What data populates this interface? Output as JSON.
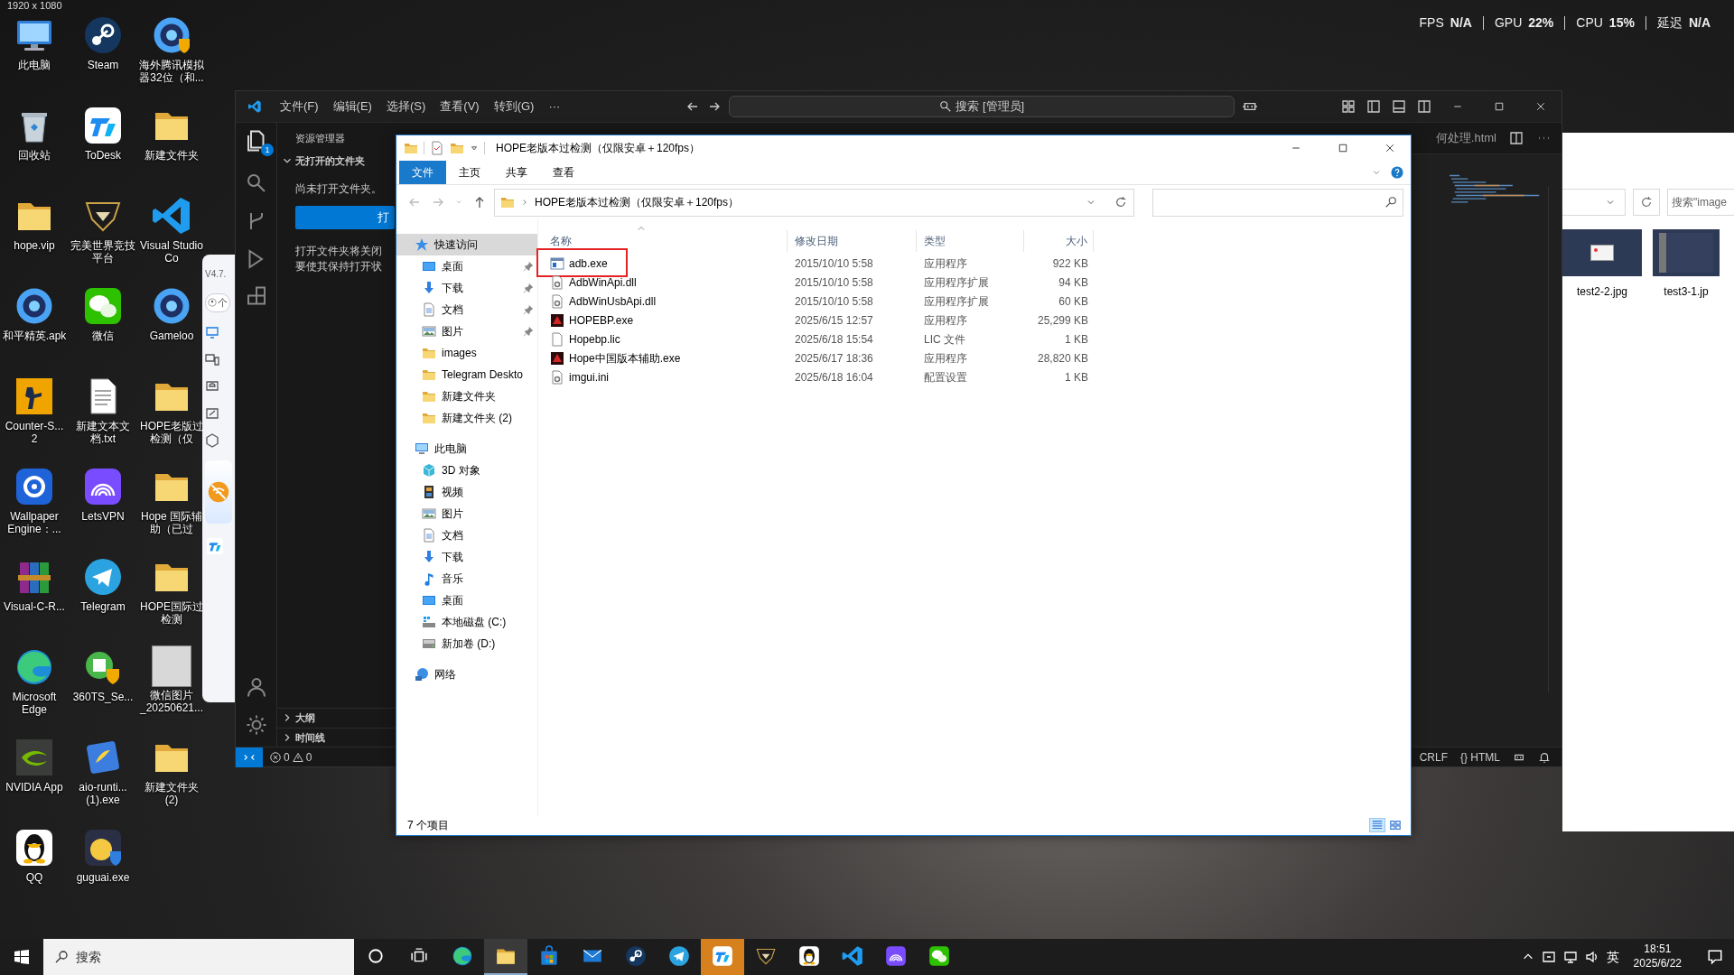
{
  "screenshot_size": "1920 x 1080",
  "perf_overlay": [
    {
      "label": "FPS",
      "value": "N/A"
    },
    {
      "label": "GPU",
      "value": "22%"
    },
    {
      "label": "CPU",
      "value": "15%"
    },
    {
      "label": "延迟",
      "value": "N/A"
    }
  ],
  "desktop_icons": [
    {
      "label": "此电脑",
      "kind": "pc"
    },
    {
      "label": "回收站",
      "kind": "bin"
    },
    {
      "label": "hope.vip",
      "kind": "folder"
    },
    {
      "label": "和平精英.apk",
      "kind": "ring"
    },
    {
      "label": "Counter-S... 2",
      "kind": "cs"
    },
    {
      "label": "Wallpaper Engine：...",
      "kind": "wallpaper"
    },
    {
      "label": "Visual-C-R...",
      "kind": "winrar"
    },
    {
      "label": "Microsoft Edge",
      "kind": "edge"
    },
    {
      "label": "NVIDIA App",
      "kind": "nvidia"
    },
    {
      "label": "QQ",
      "kind": "qq"
    },
    {
      "label": "Steam",
      "kind": "steam"
    },
    {
      "label": "ToDesk",
      "kind": "todesk"
    },
    {
      "label": "完美世界竞技平台",
      "kind": "perfect"
    },
    {
      "label": "微信",
      "kind": "wechat"
    },
    {
      "label": "新建文本文档.txt",
      "kind": "file"
    },
    {
      "label": "LetsVPN",
      "kind": "letsvpn"
    },
    {
      "label": "Telegram",
      "kind": "telegram"
    },
    {
      "label": "360TS_Se...",
      "kind": "shield360"
    },
    {
      "label": "aio-runti... (1).exe",
      "kind": "aio"
    },
    {
      "label": "guguai.exe",
      "kind": "guguai"
    },
    {
      "label": "海外腾讯模拟器32位（和...",
      "kind": "emulator"
    },
    {
      "label": "新建文件夹",
      "kind": "folder"
    },
    {
      "label": "Visual Studio Co",
      "kind": "vscode"
    },
    {
      "label": "Gameloo",
      "kind": "ring"
    },
    {
      "label": "HOPE老版过检测（仅",
      "kind": "folder"
    },
    {
      "label": "Hope 国际辅助（已过",
      "kind": "folder"
    },
    {
      "label": "HOPE国际过检测",
      "kind": "folder"
    },
    {
      "label": "微信图片\n_20250621...",
      "kind": "photo"
    },
    {
      "label": "新建文件夹\n(2)",
      "kind": "folder"
    }
  ],
  "side_panel": {
    "version": "V4.7.",
    "account": "个"
  },
  "vscode": {
    "menu": [
      "文件(F)",
      "编辑(E)",
      "选择(S)",
      "查看(V)",
      "转到(G)",
      "···"
    ],
    "search": "搜索 [管理员]",
    "explorer_badge": "1",
    "sidebar_title": "资源管理器",
    "section": {
      "label": "无打开的文件夹",
      "expanded": true
    },
    "no_folder_text": "尚未打开文件夹。",
    "open_button": "打",
    "hint_lines": [
      "打开文件夹将关闭",
      "要使其保持打开状"
    ],
    "bottom_sections": [
      {
        "label": "大纲",
        "expanded": false
      },
      {
        "label": "时间线",
        "expanded": false
      }
    ],
    "tab": "何处理.html",
    "errors": "0",
    "warnings": "0",
    "status_right": [
      "CRLF",
      "{} HTML"
    ]
  },
  "explorer": {
    "title": "HOPE老版本过检测（仅限安卓＋120fps）",
    "ribbon_tabs": [
      {
        "label": "文件",
        "selected": true
      },
      {
        "label": "主页",
        "selected": false
      },
      {
        "label": "共享",
        "selected": false
      },
      {
        "label": "查看",
        "selected": false
      }
    ],
    "path": "HOPE老版本过检测（仅限安卓＋120fps）",
    "nav": [
      {
        "label": "快速访问",
        "kind": "star",
        "selected": true,
        "children": [
          {
            "label": "桌面",
            "kind": "desktop",
            "pinned": true,
            "selected": false
          },
          {
            "label": "下载",
            "kind": "download",
            "pinned": true,
            "selected": false
          },
          {
            "label": "文档",
            "kind": "doc",
            "pinned": true,
            "selected": false
          },
          {
            "label": "图片",
            "kind": "picture",
            "pinned": true,
            "selected": false
          },
          {
            "label": "images",
            "kind": "folder",
            "pinned": false,
            "selected": false
          },
          {
            "label": "Telegram Deskto",
            "kind": "folder",
            "pinned": false,
            "selected": false
          },
          {
            "label": "新建文件夹",
            "kind": "folder",
            "pinned": false,
            "selected": false
          },
          {
            "label": "新建文件夹 (2)",
            "kind": "folder",
            "pinned": false,
            "selected": false
          }
        ]
      },
      {
        "label": "此电脑",
        "kind": "pc",
        "selected": false,
        "children": [
          {
            "label": "3D 对象",
            "kind": "cube",
            "pinned": false,
            "selected": false
          },
          {
            "label": "视频",
            "kind": "video",
            "pinned": false,
            "selected": false
          },
          {
            "label": "图片",
            "kind": "picture",
            "pinned": false,
            "selected": false
          },
          {
            "label": "文档",
            "kind": "doc",
            "pinned": false,
            "selected": false
          },
          {
            "label": "下载",
            "kind": "download",
            "pinned": false,
            "selected": false
          },
          {
            "label": "音乐",
            "kind": "music",
            "pinned": false,
            "selected": false
          },
          {
            "label": "桌面",
            "kind": "desktop",
            "pinned": false,
            "selected": false
          },
          {
            "label": "本地磁盘 (C:)",
            "kind": "drivec",
            "pinned": false,
            "selected": false
          },
          {
            "label": "新加卷 (D:)",
            "kind": "drive",
            "pinned": false,
            "selected": false
          }
        ]
      },
      {
        "label": "网络",
        "kind": "network",
        "selected": false
      }
    ],
    "columns": [
      "名称",
      "修改日期",
      "类型",
      "大小"
    ],
    "files": [
      {
        "name": "adb.exe",
        "kind": "exe",
        "date": "2015/10/10 5:58",
        "type": "应用程序",
        "size": "922 KB",
        "annotated": true
      },
      {
        "name": "AdbWinApi.dll",
        "kind": "dll",
        "date": "2015/10/10 5:58",
        "type": "应用程序扩展",
        "size": "94 KB",
        "annotated": false
      },
      {
        "name": "AdbWinUsbApi.dll",
        "kind": "dll",
        "date": "2015/10/10 5:58",
        "type": "应用程序扩展",
        "size": "60 KB",
        "annotated": false
      },
      {
        "name": "HOPEBP.exe",
        "kind": "hope",
        "date": "2025/6/15 12:57",
        "type": "应用程序",
        "size": "25,299 KB",
        "annotated": false
      },
      {
        "name": "Hopebp.lic",
        "kind": "lic",
        "date": "2025/6/18 15:54",
        "type": "LIC 文件",
        "size": "1 KB",
        "annotated": false
      },
      {
        "name": "Hope中国版本辅助.exe",
        "kind": "hope",
        "date": "2025/6/17 18:36",
        "type": "应用程序",
        "size": "28,820 KB",
        "annotated": false
      },
      {
        "name": "imgui.ini",
        "kind": "ini",
        "date": "2025/6/18 16:04",
        "type": "配置设置",
        "size": "1 KB",
        "annotated": false
      }
    ],
    "item_count": "7 个项目",
    "view_modes": [
      {
        "kind": "details",
        "selected": true
      },
      {
        "kind": "tiles",
        "selected": false
      }
    ]
  },
  "background_window": {
    "search_placeholder": "搜索\"image",
    "thumbnails": [
      {
        "label": "test2-2.jpg",
        "kind": "dialog"
      },
      {
        "label": "test3-1.jp",
        "kind": "screen"
      }
    ]
  },
  "taskbar": {
    "search_placeholder": "搜索",
    "apps": [
      {
        "kind": "edge",
        "active": false,
        "attention": false
      },
      {
        "kind": "explorer",
        "active": true,
        "attention": false
      },
      {
        "kind": "store",
        "active": false,
        "attention": false
      },
      {
        "kind": "mail",
        "active": false,
        "attention": false
      },
      {
        "kind": "steam",
        "active": false,
        "attention": false
      },
      {
        "kind": "telegram",
        "active": false,
        "attention": false
      },
      {
        "kind": "todesk",
        "active": false,
        "attention": true
      },
      {
        "kind": "perfect",
        "active": false,
        "attention": false
      },
      {
        "kind": "qq",
        "active": false,
        "attention": false
      },
      {
        "kind": "vscode",
        "active": false,
        "attention": false
      },
      {
        "kind": "letsvpn",
        "active": false,
        "attention": false
      },
      {
        "kind": "wechat",
        "active": false,
        "attention": false
      }
    ],
    "ime": "英",
    "time": "18:51",
    "date": "2025/6/22"
  }
}
